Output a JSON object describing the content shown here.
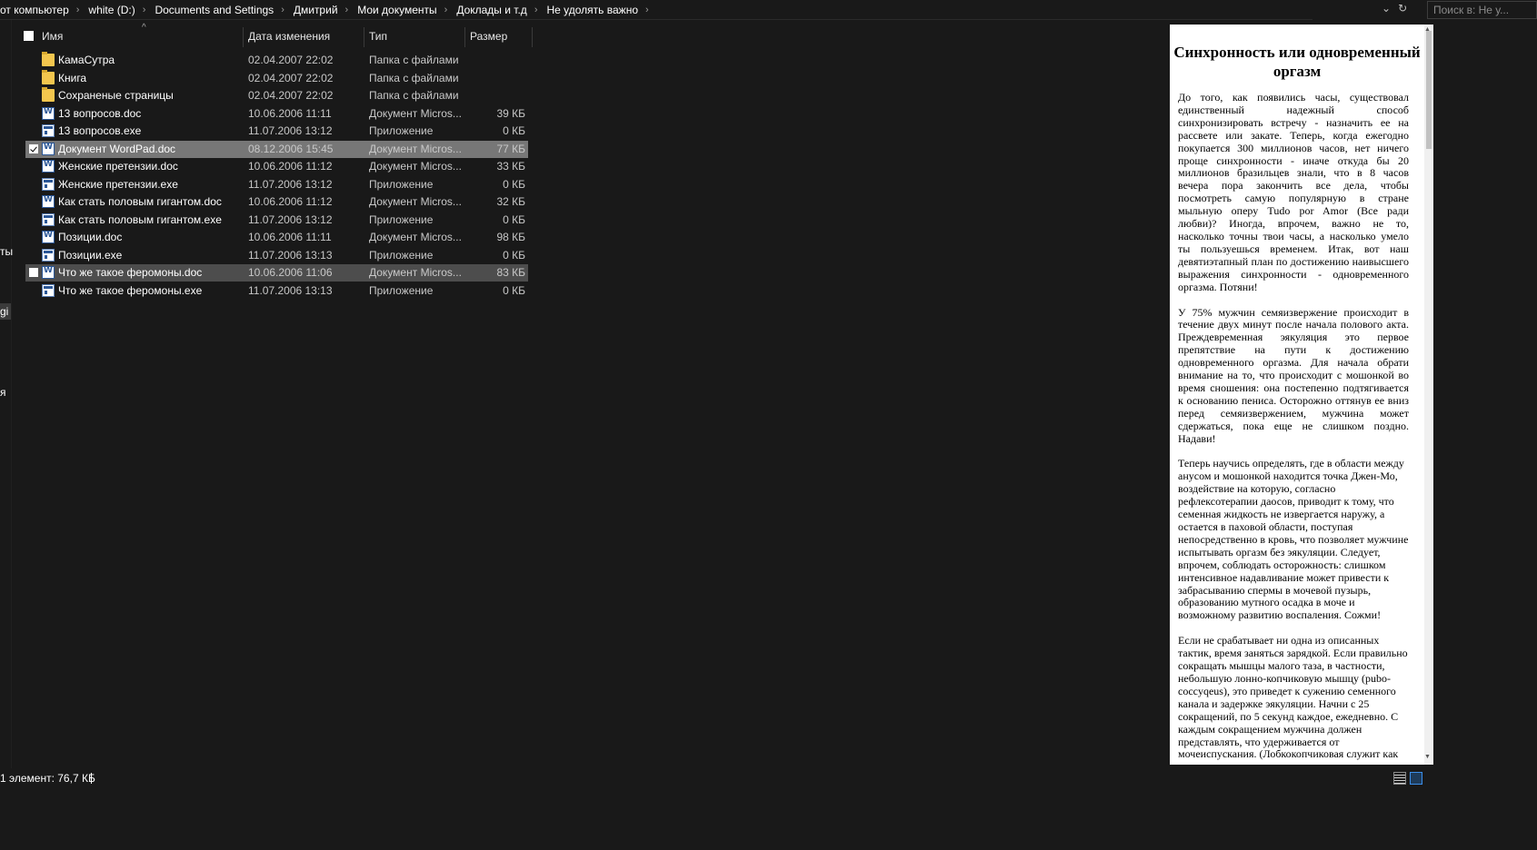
{
  "breadcrumbs": [
    {
      "label": "от компьютер"
    },
    {
      "label": "white (D:)"
    },
    {
      "label": "Documents and Settings"
    },
    {
      "label": "Дмитрий"
    },
    {
      "label": "Мои документы"
    },
    {
      "label": "Доклады и т.д"
    },
    {
      "label": "Не удолять важно"
    }
  ],
  "address_controls": {
    "dropdown_icon": "chevron-down-icon",
    "refresh_icon": "refresh-icon"
  },
  "search": {
    "placeholder": "Поиск в: Не у..."
  },
  "nav_fragments": [
    "ты",
    "gi",
    "я"
  ],
  "columns": {
    "name": "Имя",
    "date": "Дата изменения",
    "type": "Тип",
    "size": "Размер"
  },
  "files": [
    {
      "name": "КамаСутра",
      "date": "02.04.2007 22:02",
      "type": "Папка с файлами",
      "size": "",
      "icon": "folder-icon",
      "state": "normal",
      "checked": false
    },
    {
      "name": "Книга",
      "date": "02.04.2007 22:02",
      "type": "Папка с файлами",
      "size": "",
      "icon": "folder-icon",
      "state": "normal",
      "checked": false
    },
    {
      "name": "Сохраненые страницы",
      "date": "02.04.2007 22:02",
      "type": "Папка с файлами",
      "size": "",
      "icon": "folder-icon",
      "state": "normal",
      "checked": false
    },
    {
      "name": "13 вопросов.doc",
      "date": "10.06.2006 11:11",
      "type": "Документ Micros...",
      "size": "39 КБ",
      "icon": "word-doc-icon",
      "state": "normal",
      "checked": false
    },
    {
      "name": "13 вопросов.exe",
      "date": "11.07.2006 13:12",
      "type": "Приложение",
      "size": "0 КБ",
      "icon": "application-icon",
      "state": "normal",
      "checked": false
    },
    {
      "name": "Документ WordPad.doc",
      "date": "08.12.2006 15:45",
      "type": "Документ Micros...",
      "size": "77 КБ",
      "icon": "word-doc-icon",
      "state": "selected",
      "checked": true
    },
    {
      "name": "Женские претензии.doc",
      "date": "10.06.2006 11:12",
      "type": "Документ Micros...",
      "size": "33 КБ",
      "icon": "word-doc-icon",
      "state": "normal",
      "checked": false
    },
    {
      "name": "Женские претензии.exe",
      "date": "11.07.2006 13:12",
      "type": "Приложение",
      "size": "0 КБ",
      "icon": "application-icon",
      "state": "normal",
      "checked": false
    },
    {
      "name": "Как стать половым гигантом.doc",
      "date": "10.06.2006 11:12",
      "type": "Документ Micros...",
      "size": "32 КБ",
      "icon": "word-doc-icon",
      "state": "normal",
      "checked": false
    },
    {
      "name": "Как стать половым гигантом.exe",
      "date": "11.07.2006 13:12",
      "type": "Приложение",
      "size": "0 КБ",
      "icon": "application-icon",
      "state": "normal",
      "checked": false
    },
    {
      "name": "Позиции.doc",
      "date": "10.06.2006 11:11",
      "type": "Документ Micros...",
      "size": "98 КБ",
      "icon": "word-doc-icon",
      "state": "normal",
      "checked": false
    },
    {
      "name": "Позиции.exe",
      "date": "11.07.2006 13:13",
      "type": "Приложение",
      "size": "0 КБ",
      "icon": "application-icon",
      "state": "normal",
      "checked": false
    },
    {
      "name": "Что же такое феромоны.doc",
      "date": "10.06.2006 11:06",
      "type": "Документ Micros...",
      "size": "83 КБ",
      "icon": "word-doc-icon",
      "state": "hover",
      "checked": false
    },
    {
      "name": "Что же такое феромоны.exe",
      "date": "11.07.2006 13:13",
      "type": "Приложение",
      "size": "0 КБ",
      "icon": "application-icon",
      "state": "normal",
      "checked": false
    }
  ],
  "preview": {
    "title": "Синхронность или одновременный оргазм",
    "paragraphs": [
      "До того, как появились часы, существовал единственный надежный способ синхронизировать встречу - назначить ее на рассвете или закате. Теперь, когда ежегодно покупается 300 миллионов часов, нет ничего проще синхронности - иначе откуда бы 20 миллионов бразильцев знали, что в 8 часов вечера пора закончить все дела, чтобы посмотреть самую популярную в стране мыльную оперу Tudo por Amor (Все ради любви)? Иногда, впрочем, важно не то, насколько точны твои часы, а насколько умело ты пользуешься временем. Итак, вот наш девятиэтапный план по достижению наивысшего выражения синхронности - одновременного оргазма. Потяни!",
      "У 75% мужчин семяизвержение происходит в течение двух минут после начала полового акта. Преждевременная эякуляция это первое препятствие на пути к достижению одновременного оргазма. Для начала обрати внимание на то, что происходит с мошонкой во время сношения: она постепенно подтягивается к основанию пениса. Осторожно оттянув ее вниз перед семяизвержением, мужчина может сдержаться, пока еще не слишком поздно. Надави!",
      "Теперь научись определять, где в области между анусом и мошонкой находится точка Джен-Мо, воздействие на которую, согласно рефлексотерапии даосов, приводит к тому, что семенная жидкость не извергается наружу, а остается в паховой области, поступая непосредственно в кровь, что позволяет мужчине испытывать оргазм без эякуляции. Следует, впрочем, соблюдать осторожность: слишком интенсивное надавливание может привести к забрасыванию спермы в мочевой пузырь, образованию мутного осадка в моче и возможному развитию воспаления. Сожми!",
      "Если не срабатывает ни одна из описанных тактик, время заняться зарядкой. Если правильно сокращать мышцы малого таза, в частности, небольшую лонно-копчиковую мышцу (pubo-coccyqeus), это приведет к сужению семенного канала и задержке эякуляции. Начни с 25 сокращений, по 5 секунд каждое, ежедневно. С каждым сокращением мужчина должен представлять, что удерживается от мочеиспускания. (Лобкокопчиковая служит как раз для контроля за"
    ]
  },
  "status": {
    "text": "1 элемент: 76,7 КБ"
  },
  "view_buttons": [
    "details-view-icon",
    "large-icons-view-icon"
  ]
}
